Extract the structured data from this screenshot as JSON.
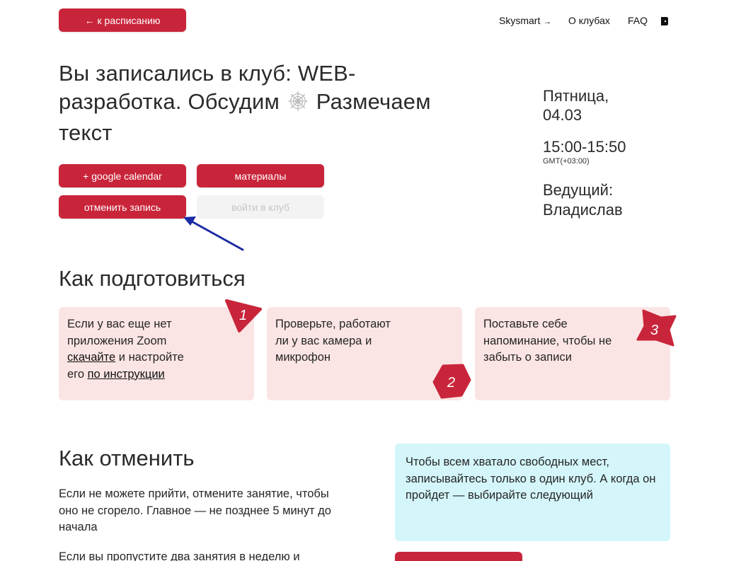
{
  "top": {
    "back_button": "← к расписанию",
    "nav": {
      "skysmart": "Skysmart",
      "skysmart_arrow": "→",
      "about_clubs": "О клубах",
      "faq": "FAQ"
    }
  },
  "club": {
    "title_part1": "Вы записались в клуб: WEB-разработка. Обсудим",
    "title_icon": "spider-web-icon",
    "title_part2": "Размечаем текст"
  },
  "actions": {
    "google_calendar": "+ google calendar",
    "materials": "материалы",
    "cancel": "отменить запись",
    "enter_club": "войти в клуб"
  },
  "schedule": {
    "day": "Пятница,",
    "date": "04.03",
    "time": "15:00-15:50",
    "timezone": "GMT(+03:00)",
    "host_label": "Ведущий:",
    "host_name": "Владислав"
  },
  "prepare": {
    "heading": "Как подготовиться",
    "steps": [
      {
        "number": "1",
        "text_line1": "Если у вас еще нет",
        "text_line2": "приложения Zoom",
        "download_link": "скачайте",
        "text_after_link": " и настройте",
        "text_line4_prefix": "его ",
        "instructions_link": "по инструкции"
      },
      {
        "number": "2",
        "text": "Проверьте, работают ли у вас камера и микрофон"
      },
      {
        "number": "3",
        "text": "Поставьте себе напоминание, чтобы не забыть о записи"
      }
    ]
  },
  "cancel_section": {
    "heading": "Как отменить",
    "paragraph1": "Если не можете прийти, отмените занятие, чтобы оно не сгорело. Главное — не позднее 5 минут до начала",
    "paragraph2": "Если вы пропустите два занятия в неделю и"
  },
  "notice": {
    "text": "Чтобы всем хватало свободных мест, записывайтесь только в один клуб. А когда он пройдет — выбирайте следующий"
  },
  "colors": {
    "accent": "#c9253a",
    "card_bg": "#fbe5e4",
    "notice_bg": "#d4f6fb",
    "annotation_arrow": "#1b2aa3"
  }
}
